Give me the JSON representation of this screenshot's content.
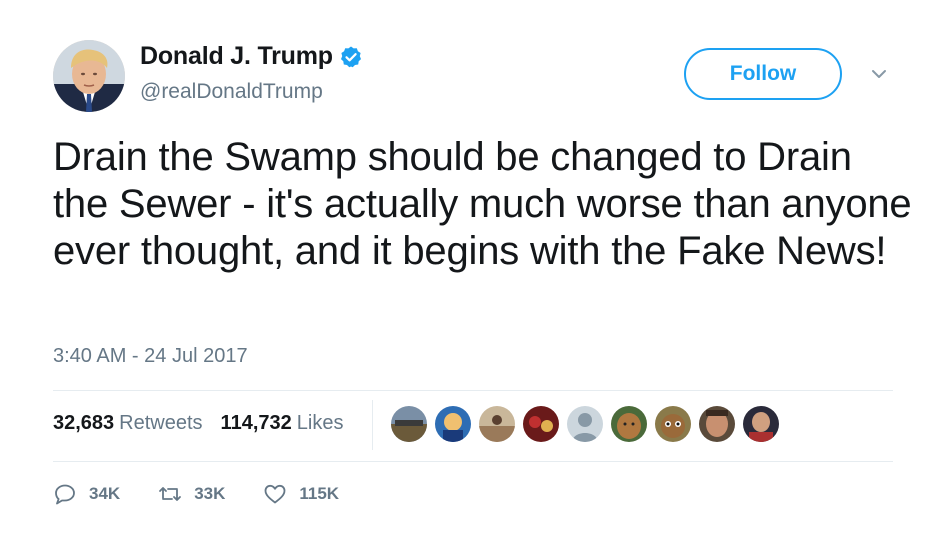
{
  "user": {
    "display_name": "Donald J. Trump",
    "handle": "@realDonaldTrump",
    "verified": true
  },
  "follow_button": {
    "label": "Follow"
  },
  "tweet": {
    "text": "Drain the Swamp should be changed to Drain the Sewer - it's actually much worse than anyone ever thought, and it begins with the Fake News!",
    "timestamp": "3:40 AM - 24 Jul 2017"
  },
  "stats": {
    "retweets_count": "32,683",
    "retweets_label": "Retweets",
    "likes_count": "114,732",
    "likes_label": "Likes"
  },
  "liker_avatars": [
    "liker-avatar-1",
    "liker-avatar-2",
    "liker-avatar-3",
    "liker-avatar-4",
    "liker-avatar-5",
    "liker-avatar-6",
    "liker-avatar-7",
    "liker-avatar-8",
    "liker-avatar-9"
  ],
  "actions": {
    "reply_count": "34K",
    "retweet_count": "33K",
    "like_count": "115K"
  },
  "colors": {
    "accent": "#1da1f2",
    "text": "#14171a",
    "secondary": "#657786",
    "divider": "#e6ecf0"
  },
  "icons": [
    "verified-badge-icon",
    "chevron-down-icon",
    "reply-icon",
    "retweet-icon",
    "heart-icon"
  ]
}
